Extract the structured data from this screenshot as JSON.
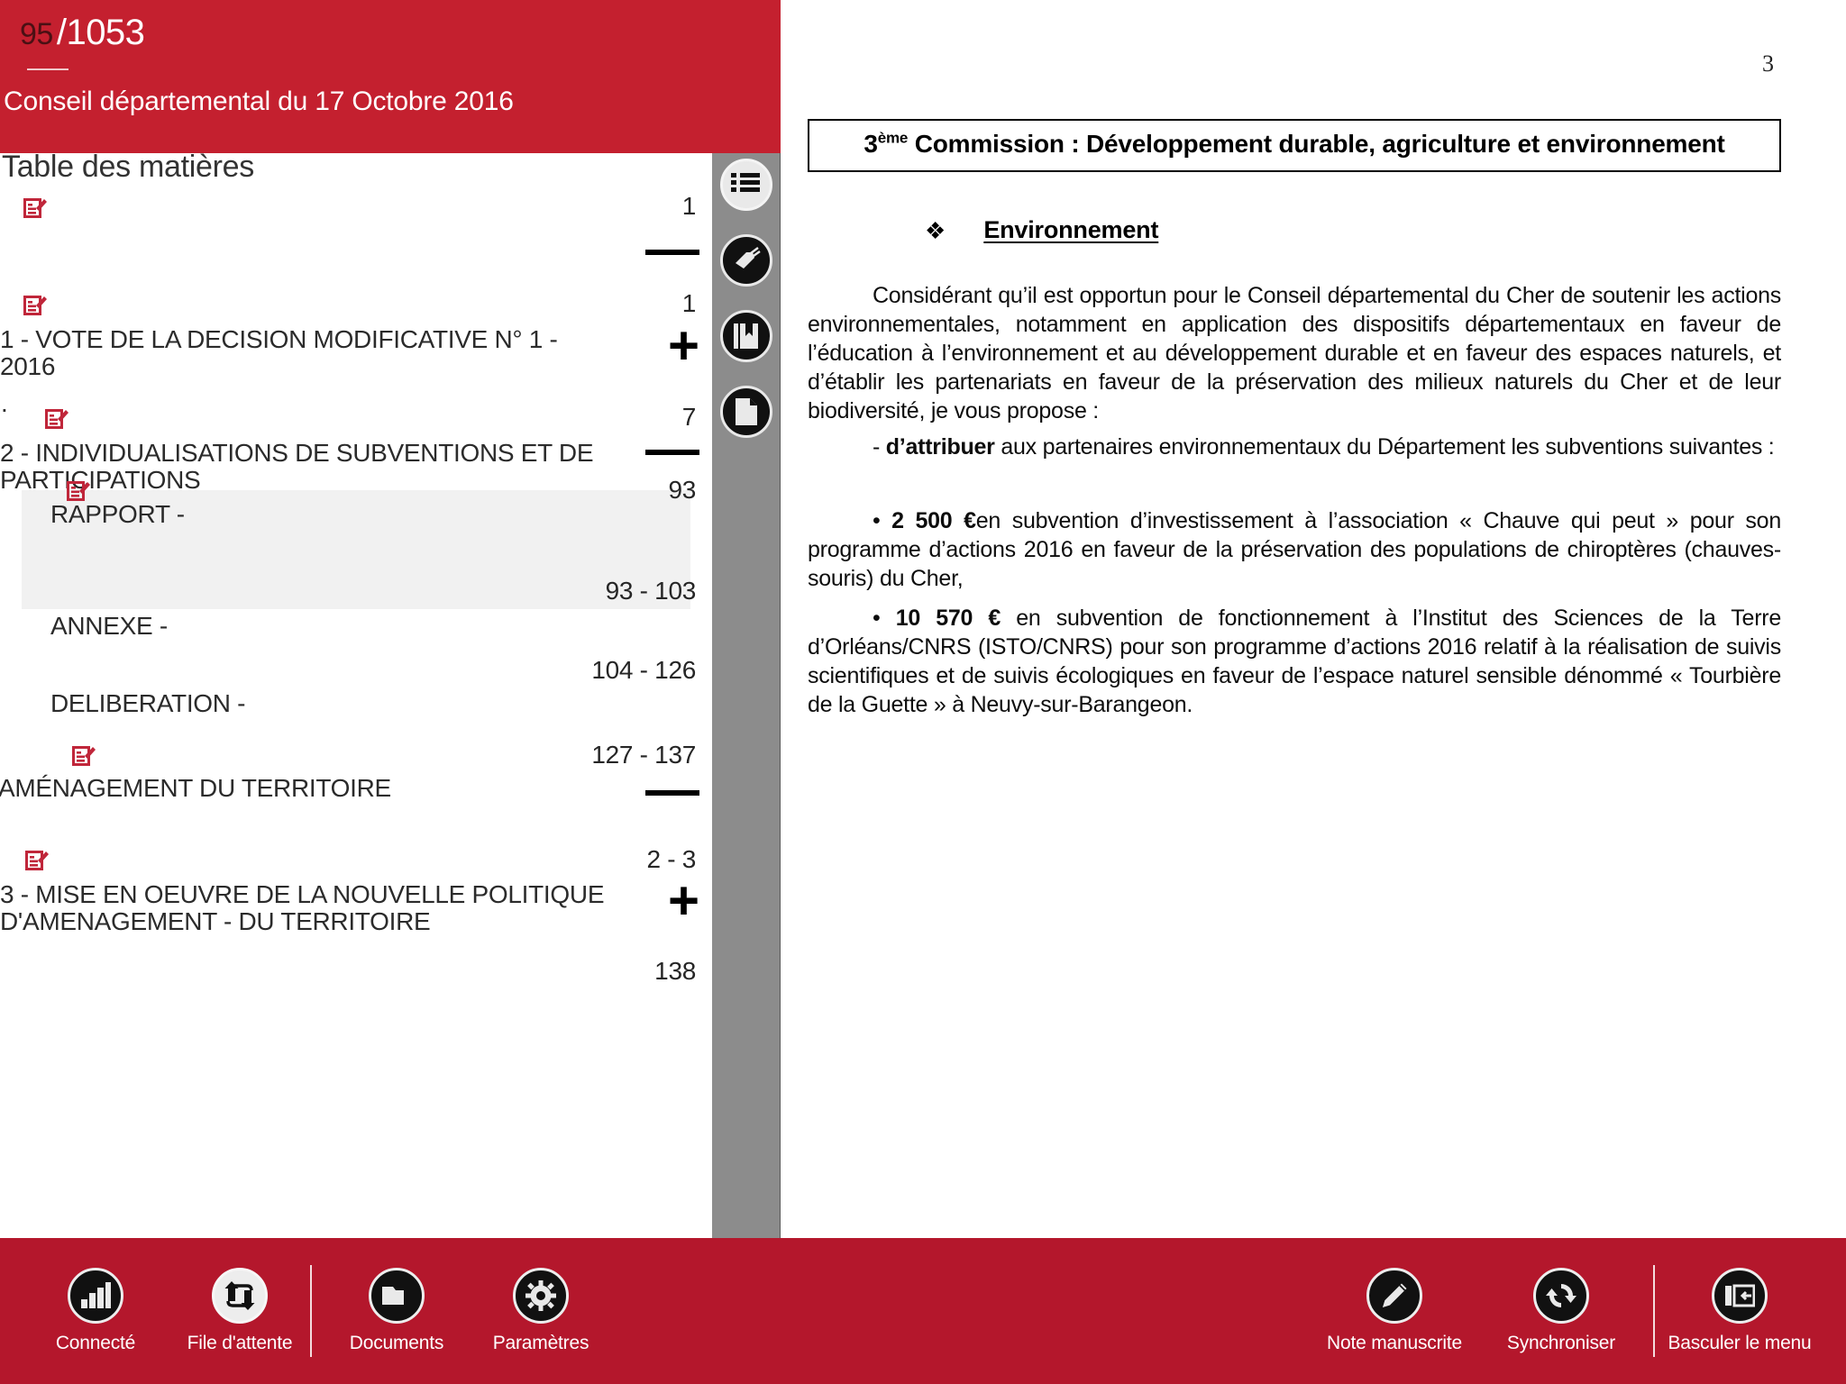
{
  "header": {
    "current_page": "95",
    "total_pages": "/1053",
    "title": "Conseil départemental du 17 Octobre 2016"
  },
  "toc": {
    "heading": "Table des matières",
    "dot_marker": ".",
    "entries": [
      {
        "label": "",
        "pages": "1",
        "toggle": "—",
        "icon": "document-edit-icon"
      },
      {
        "label": "1 - VOTE DE LA DECISION MODIFICATIVE N° 1 - 2016",
        "pages": "1",
        "toggle": "+",
        "icon": "document-edit-icon"
      },
      {
        "label": "2 - INDIVIDUALISATIONS DE SUBVENTIONS ET DE PARTICIPATIONS",
        "pages": "7",
        "toggle": "—",
        "icon": "document-edit-icon"
      },
      {
        "label": "RAPPORT -",
        "pages": "93",
        "toggle": "",
        "icon": "document-edit-icon"
      },
      {
        "label": "ANNEXE -",
        "pages": "93 - 103",
        "toggle": "",
        "icon": ""
      },
      {
        "label": "DELIBERATION -",
        "pages": "104 - 126",
        "toggle": "",
        "icon": ""
      },
      {
        "label": "AMÉNAGEMENT DU TERRITOIRE",
        "pages": "127 - 137",
        "toggle": "—",
        "icon": "document-edit-icon"
      },
      {
        "label": "3 - MISE EN OEUVRE DE LA NOUVELLE POLITIQUE D'AMENAGEMENT - DU TERRITOIRE",
        "pages": "2 - 3",
        "toggle": "+",
        "icon": "document-edit-icon"
      },
      {
        "label": "",
        "pages": "138",
        "toggle": "",
        "icon": ""
      }
    ]
  },
  "rail": {
    "items": [
      {
        "icon": "table-of-contents-icon",
        "active": true
      },
      {
        "icon": "tag-icon",
        "active": false
      },
      {
        "icon": "bookmark-icon",
        "active": false
      },
      {
        "icon": "page-icon",
        "active": false
      }
    ]
  },
  "document": {
    "page_number": "3",
    "title_prefix": "3",
    "title_sup": "ème",
    "title_rest": " Commission : Développement durable, agriculture et environnement",
    "section_bullet": "❖",
    "section_title": "Environnement",
    "paragraph1": "Considérant qu’il est opportun pour le Conseil départemental du Cher de soutenir les actions environnementales, notamment en application des dispositifs départementaux en faveur de l’éducation à l’environnement et au développement durable et en faveur des espaces naturels, et d’établir les partenariats en faveur de la préservation des milieux naturels du Cher et de leur biodiversité, je vous propose :",
    "paragraph2_lead": "- ",
    "paragraph2_bold": "d’attribuer",
    "paragraph2_rest": " aux partenaires environnementaux du Département les subventions suivantes :",
    "paragraph3_bullet": "• ",
    "paragraph3_bold": "2 500 €",
    "paragraph3_rest": "en subvention d’investissement à l’association « Chauve qui peut » pour son programme d’actions 2016 en faveur de la préservation des populations de chiroptères (chauves-souris) du Cher,",
    "paragraph4_bullet": "• ",
    "paragraph4_bold": "10 570 €",
    "paragraph4_rest": " en subvention de fonctionnement à l’Institut des Sciences de la Terre d’Orléans/CNRS (ISTO/CNRS) pour son programme d’actions 2016 relatif à la réalisation de suivis scientifiques et de suivis écologiques en faveur de l’espace naturel sensible dénommé « Tourbière de la Guette » à Neuvy-sur-Barangeon."
  },
  "bottom_bar": {
    "left_items": [
      {
        "label": "Connecté",
        "icon": "signal-bars-icon",
        "style": "dark"
      },
      {
        "label": "File d'attente",
        "icon": "sync-queue-icon",
        "style": "light"
      }
    ],
    "mid_items": [
      {
        "label": "Documents",
        "icon": "folder-icon",
        "style": "dark"
      },
      {
        "label": "Paramètres",
        "icon": "gear-icon",
        "style": "dark"
      }
    ],
    "right_items": [
      {
        "label": "Note manuscrite",
        "icon": "pencil-icon",
        "style": "dark"
      },
      {
        "label": "Synchroniser",
        "icon": "refresh-icon",
        "style": "dark"
      }
    ],
    "far_right_items": [
      {
        "label": "Basculer le menu",
        "icon": "toggle-panel-icon",
        "style": "dark"
      }
    ]
  },
  "colors": {
    "brand_red": "#c4202f",
    "bar_red": "#b4172c",
    "rail_grey": "#8c8c8c",
    "icon_red": "#c0263a",
    "row_highlight": "#f1f1f1"
  }
}
